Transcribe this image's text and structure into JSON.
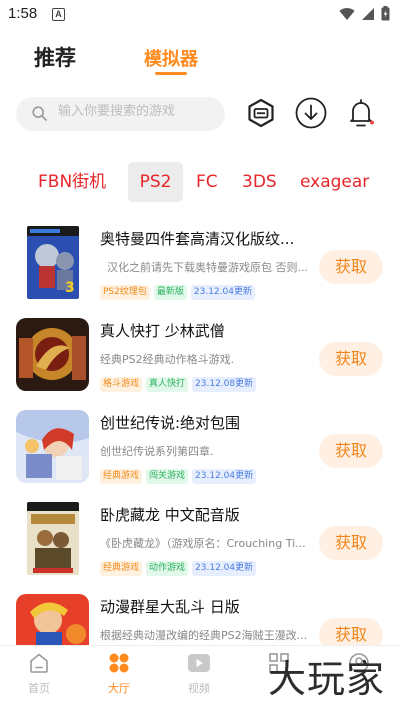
{
  "status": {
    "time": "1:58",
    "notif_letter": "A"
  },
  "tabs": [
    {
      "label": "推荐",
      "active": false
    },
    {
      "label": "模拟器",
      "active": true
    }
  ],
  "search": {
    "placeholder": "输入你要搜索的游戏"
  },
  "toolbar_icons": [
    "game-box-icon",
    "download-icon",
    "bell-icon"
  ],
  "categories": [
    {
      "label": "FBN街机",
      "active": false
    },
    {
      "label": "PS2",
      "active": true
    },
    {
      "label": "FC",
      "active": false
    },
    {
      "label": "3DS",
      "active": false
    },
    {
      "label": "exagear",
      "active": false
    }
  ],
  "games": [
    {
      "title": "奥特曼四件套高清汉化版纹...",
      "desc": "汉化之前请先下载奥特曼游戏原包 否则...",
      "tags": [
        {
          "text": "PS2纹理包",
          "color": "orange"
        },
        {
          "text": "最新版",
          "color": "green"
        },
        {
          "text": "23.12.04更新",
          "color": "blue"
        }
      ],
      "button": "获取"
    },
    {
      "title": "真人快打 少林武僧",
      "desc": "经典PS2经典动作格斗游戏.",
      "tags": [
        {
          "text": "格斗游戏",
          "color": "orange"
        },
        {
          "text": "真人快打",
          "color": "green"
        },
        {
          "text": "23.12.08更新",
          "color": "blue"
        }
      ],
      "button": "获取"
    },
    {
      "title": "创世纪传说:绝对包围",
      "desc": "创世纪传说系列第四章.",
      "tags": [
        {
          "text": "经典游戏",
          "color": "orange"
        },
        {
          "text": "闯关游戏",
          "color": "green"
        },
        {
          "text": "23.12.04更新",
          "color": "blue"
        }
      ],
      "button": "获取"
    },
    {
      "title": "卧虎藏龙 中文配音版",
      "desc": "《卧虎藏龙》（游戏原名：Crouching Ti...",
      "tags": [
        {
          "text": "经典游戏",
          "color": "orange"
        },
        {
          "text": "动作游戏",
          "color": "green"
        },
        {
          "text": "23.12.04更新",
          "color": "blue"
        }
      ],
      "button": "获取"
    },
    {
      "title": "动漫群星大乱斗 日版",
      "desc": "根据经典动漫改编的经典PS2海贼王漫改...",
      "tags": [],
      "button": "获取"
    }
  ],
  "bottom_nav": [
    {
      "label": "首页",
      "icon": "home-icon",
      "active": false
    },
    {
      "label": "大厅",
      "icon": "lobby-icon",
      "active": true
    },
    {
      "label": "视频",
      "icon": "video-icon",
      "active": false
    },
    {
      "label": "",
      "icon": "grid-icon",
      "active": false
    },
    {
      "label": "",
      "icon": "profile-icon",
      "active": false
    }
  ],
  "watermark": "大玩家",
  "colors": {
    "accent": "#ff8a1f",
    "category_red": "#e8262a"
  }
}
